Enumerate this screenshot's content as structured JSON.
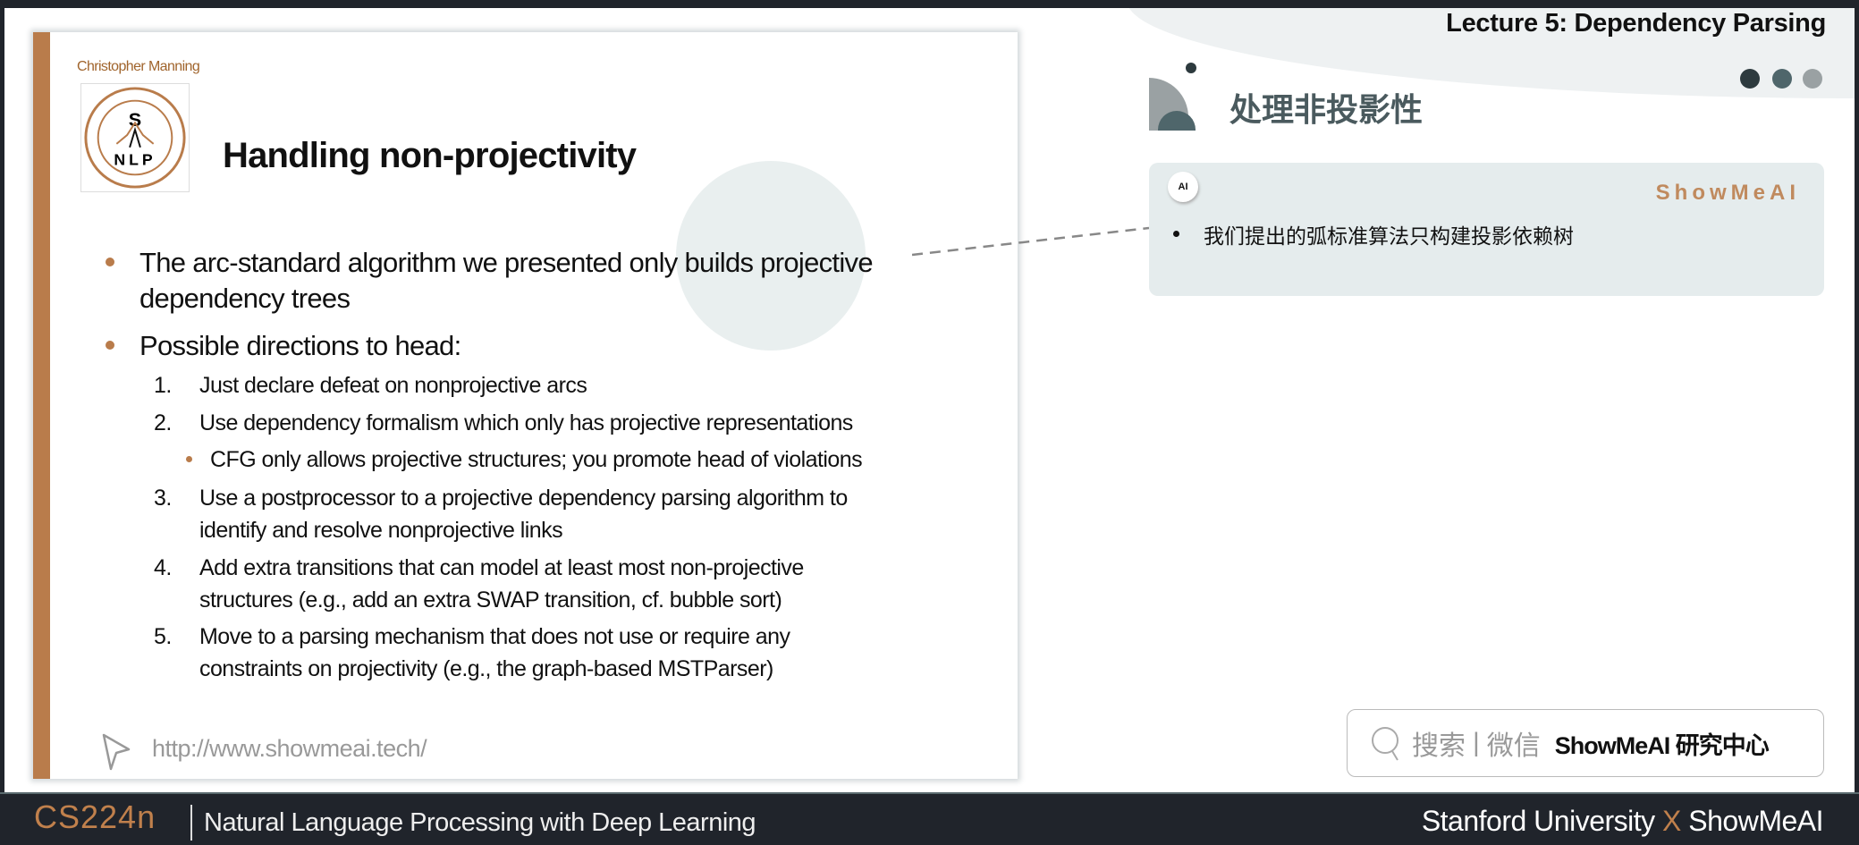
{
  "slide": {
    "author": "Christopher Manning",
    "logo_text": "Stanford University Natural Language Processing S NLP",
    "title": "Handling non-projectivity",
    "bullets": [
      {
        "lines": [
          "The arc-standard algorithm we presented only builds projective",
          "dependency trees"
        ]
      },
      {
        "lines": [
          "Possible directions to head:"
        ]
      }
    ],
    "items": [
      {
        "num": "1.",
        "lines": [
          "Just declare defeat on nonprojective arcs"
        ]
      },
      {
        "num": "2.",
        "lines": [
          "Use dependency formalism which only has projective representations"
        ],
        "sub": "CFG only allows projective structures; you promote head of violations"
      },
      {
        "num": "3.",
        "lines": [
          "Use a postprocessor to a projective dependency parsing algorithm to",
          "identify and resolve nonprojective links"
        ]
      },
      {
        "num": "4.",
        "lines": [
          "Add extra transitions that can model at least most non-projective",
          "structures (e.g., add an extra SWAP transition, cf. bubble sort)"
        ]
      },
      {
        "num": "5.",
        "lines": [
          "Move to a parsing mechanism that does not use or require any",
          "constraints on projectivity (e.g., the graph-based MSTParser)"
        ]
      }
    ],
    "url": "http://www.showmeai.tech/"
  },
  "right": {
    "lecture": "Lecture 5:  Dependency Parsing",
    "cn_title": "处理非投影性",
    "panel_brand": "ShowMeAI",
    "robot_label": "AI",
    "panel_bullet": "我们提出的弧标准算法只构建投影依赖树",
    "search": {
      "a": "搜索",
      "sep": "|",
      "b": "微信",
      "c": "ShowMeAI 研究中心"
    }
  },
  "footer": {
    "course": "CS224n",
    "subtitle": "Natural Language Processing with Deep Learning",
    "right_a": "Stanford University",
    "x": "X",
    "right_b": "ShowMeAI"
  },
  "colors": {
    "accent": "#b97c4b",
    "dark": "#20242b",
    "panel": "#e5eced"
  }
}
